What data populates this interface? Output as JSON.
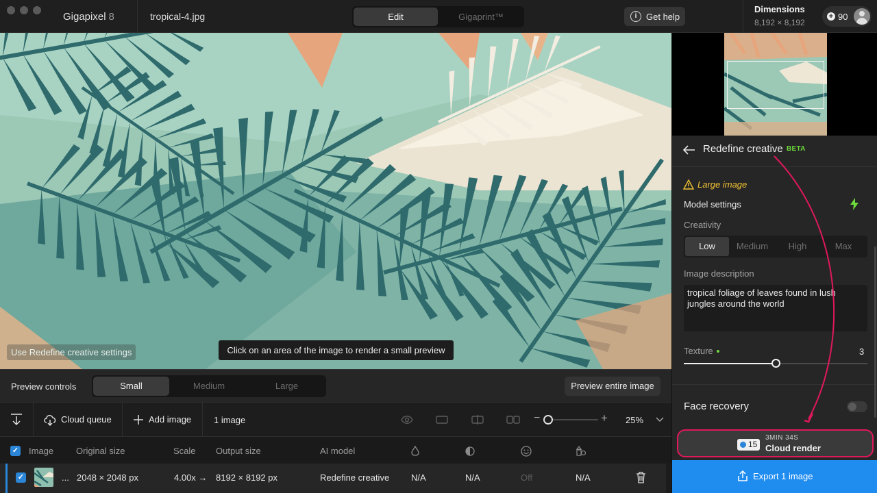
{
  "titlebar": {
    "app_name": "Gigapixel",
    "app_version": "8",
    "file_name": "tropical-4.jpg",
    "tabs": [
      {
        "label": "Edit",
        "active": true
      },
      {
        "label": "Gigaprint™",
        "active": false
      }
    ],
    "help_label": "Get help",
    "dimensions_title": "Dimensions",
    "dimensions_value": "8,192 × 8,192",
    "credits": "90"
  },
  "canvas": {
    "overlay_hint": "Use Redefine creative settings",
    "tooltip": "Click on an area of the image to render a small preview"
  },
  "preview_controls": {
    "label": "Preview controls",
    "sizes": [
      {
        "label": "Small",
        "active": true
      },
      {
        "label": "Medium",
        "active": false
      },
      {
        "label": "Large",
        "active": false
      }
    ],
    "preview_entire": "Preview entire image"
  },
  "toolbar": {
    "cloud_queue": "Cloud queue",
    "add_image": "Add image",
    "image_count": "1 image",
    "zoom": "25%"
  },
  "table": {
    "headers": {
      "image": "Image",
      "original_size": "Original size",
      "scale": "Scale",
      "output_size": "Output size",
      "ai_model": "AI model"
    },
    "rows": [
      {
        "name": "...",
        "original_size": "2048 × 2048 px",
        "scale": "4.00x →",
        "output_size": "8192 × 8192 px",
        "ai_model": "Redefine creative",
        "col1": "N/A",
        "col2": "N/A",
        "col3": "Off",
        "col4": "N/A"
      }
    ]
  },
  "panel": {
    "title": "Redefine creative",
    "beta": "BETA",
    "warning": "Large image",
    "model_settings": "Model settings",
    "creativity_label": "Creativity",
    "creativity_options": [
      {
        "label": "Low",
        "active": true
      },
      {
        "label": "Medium",
        "active": false
      },
      {
        "label": "High",
        "active": false
      },
      {
        "label": "Max",
        "active": false
      }
    ],
    "description_label": "Image description",
    "description_value": "tropical foliage of leaves found in lush jungles around the world",
    "texture_label": "Texture",
    "texture_value": "3",
    "texture_level": 0.5,
    "face_recovery_label": "Face recovery",
    "face_recovery_on": false,
    "cloud_credits": "15",
    "cloud_time": "3MIN 34S",
    "cloud_render_label": "Cloud render",
    "export_label": "Export 1 image"
  },
  "colors": {
    "accent_blue": "#1f8cf0",
    "beta_green": "#6edb3c",
    "warning_yellow": "#f1c232",
    "annotation_pink": "#e0195a"
  }
}
